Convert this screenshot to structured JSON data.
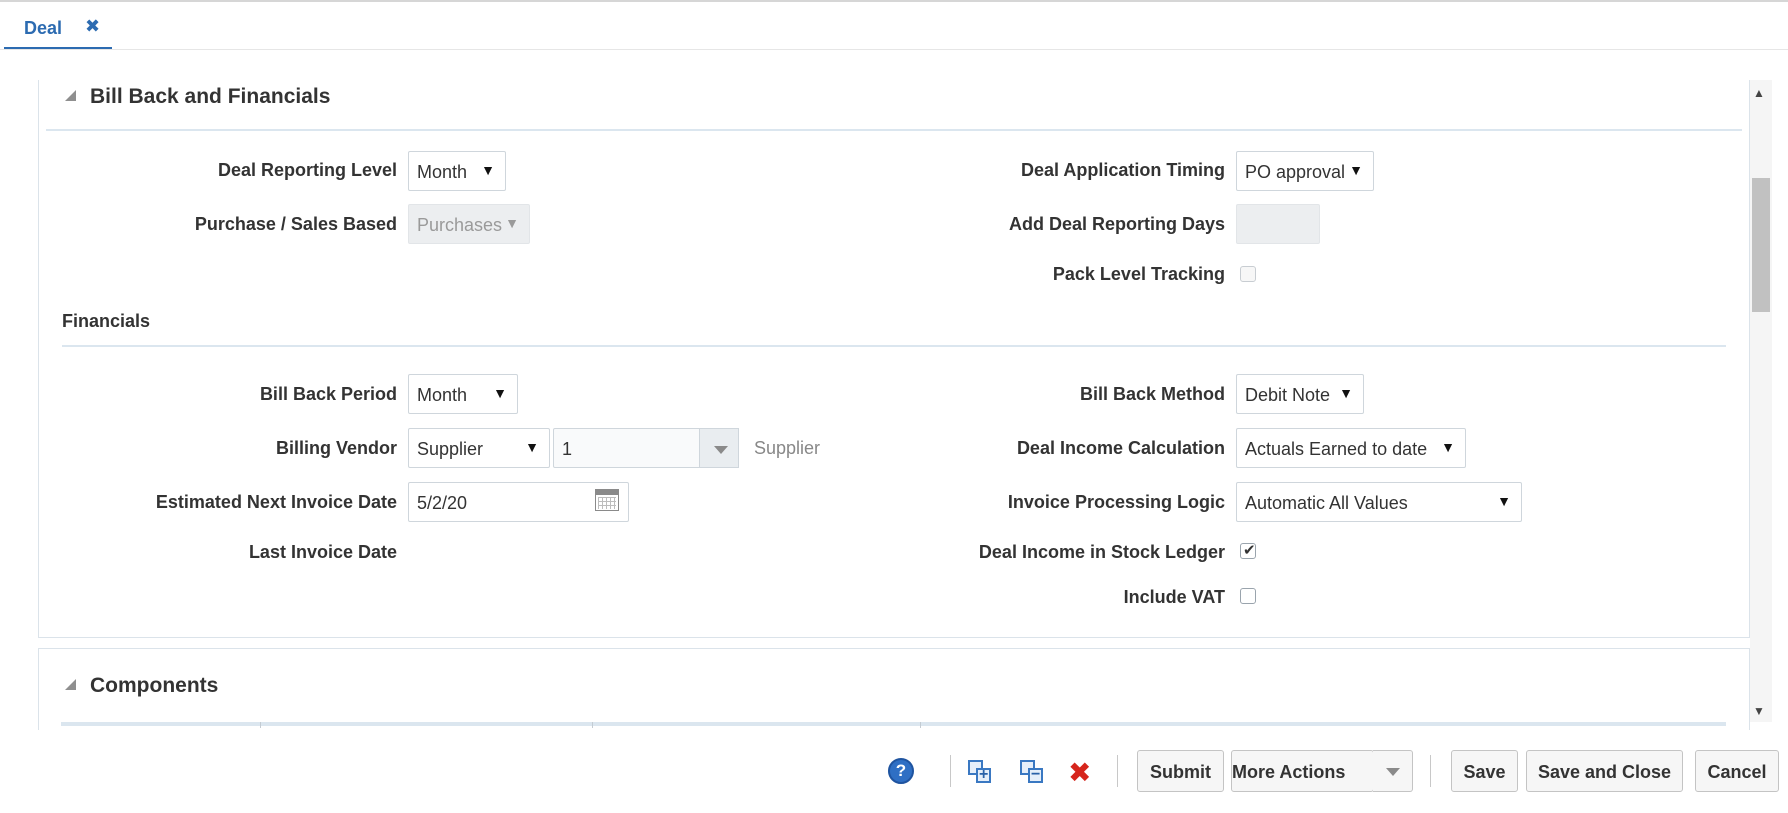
{
  "tabs": [
    {
      "label": "Deal",
      "close": "✖"
    }
  ],
  "sections": {
    "bill_back": {
      "title": "Bill Back and Financials",
      "deal_reporting_level": {
        "label": "Deal Reporting Level",
        "value": "Month"
      },
      "purchase_sales_based": {
        "label": "Purchase / Sales Based",
        "value": "Purchases"
      },
      "deal_application_timing": {
        "label": "Deal Application Timing",
        "value": "PO approval"
      },
      "add_deal_reporting_days": {
        "label": "Add Deal Reporting Days",
        "value": ""
      },
      "pack_level_tracking": {
        "label": "Pack Level Tracking",
        "checked": false
      }
    },
    "financials": {
      "title": "Financials",
      "bill_back_period": {
        "label": "Bill Back Period",
        "value": "Month"
      },
      "billing_vendor": {
        "label": "Billing Vendor",
        "type_value": "Supplier",
        "id_value": "1",
        "name": "Supplier"
      },
      "estimated_next_invoice_date": {
        "label": "Estimated Next Invoice Date",
        "value": "5/2/20"
      },
      "last_invoice_date": {
        "label": "Last Invoice Date",
        "value": ""
      },
      "bill_back_method": {
        "label": "Bill Back Method",
        "value": "Debit Note"
      },
      "deal_income_calculation": {
        "label": "Deal Income Calculation",
        "value": "Actuals Earned to date"
      },
      "invoice_processing_logic": {
        "label": "Invoice Processing Logic",
        "value": "Automatic All Values"
      },
      "deal_income_in_stock_ledger": {
        "label": "Deal Income in Stock Ledger",
        "checked": true
      },
      "include_vat": {
        "label": "Include VAT",
        "checked": false
      }
    },
    "components": {
      "title": "Components"
    }
  },
  "icons": {
    "dropdown": "▼",
    "checkmark": "✔",
    "disclosure": "disclosure-triangle-icon",
    "scroll_up": "▲",
    "scroll_down": "▼",
    "help": "?",
    "delete": "✖"
  },
  "footer": {
    "submit": "Submit",
    "more_actions": "More Actions",
    "save": "Save",
    "save_and_close": "Save and Close",
    "cancel": "Cancel"
  },
  "colors": {
    "accent": "#2c6bb1",
    "delete": "#d6251c"
  }
}
